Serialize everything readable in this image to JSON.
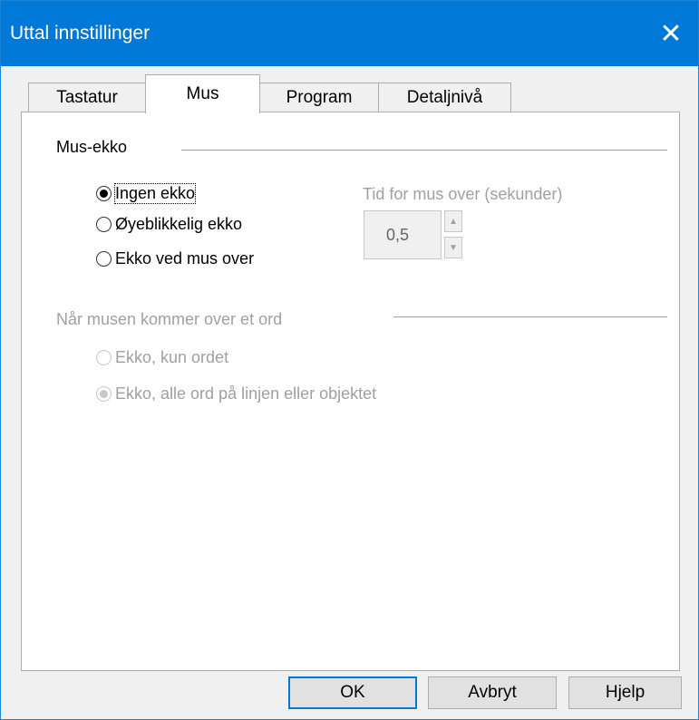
{
  "window": {
    "title": "Uttal innstillinger",
    "close_glyph": "✕"
  },
  "tabs": [
    {
      "label": "Tastatur",
      "active": false
    },
    {
      "label": "Mus",
      "active": true
    },
    {
      "label": "Program",
      "active": false
    },
    {
      "label": "Detaljnivå",
      "active": false
    }
  ],
  "mouse_echo": {
    "group_label": "Mus-ekko",
    "options": [
      {
        "label": "Ingen ekko",
        "selected": true
      },
      {
        "label": "Øyeblikkelig ekko",
        "selected": false
      },
      {
        "label": "Ekko ved mus over",
        "selected": false
      }
    ],
    "hover_time": {
      "label": "Tid for mus over (sekunder)",
      "value": "0,5",
      "up_glyph": "▲",
      "down_glyph": "▼"
    }
  },
  "word_hover": {
    "group_label": "Når musen kommer over et ord",
    "options": [
      {
        "label": "Ekko, kun ordet",
        "selected": false
      },
      {
        "label": "Ekko, alle ord på linjen eller objektet",
        "selected": true
      }
    ]
  },
  "buttons": {
    "ok": "OK",
    "cancel": "Avbryt",
    "help": "Hjelp"
  }
}
